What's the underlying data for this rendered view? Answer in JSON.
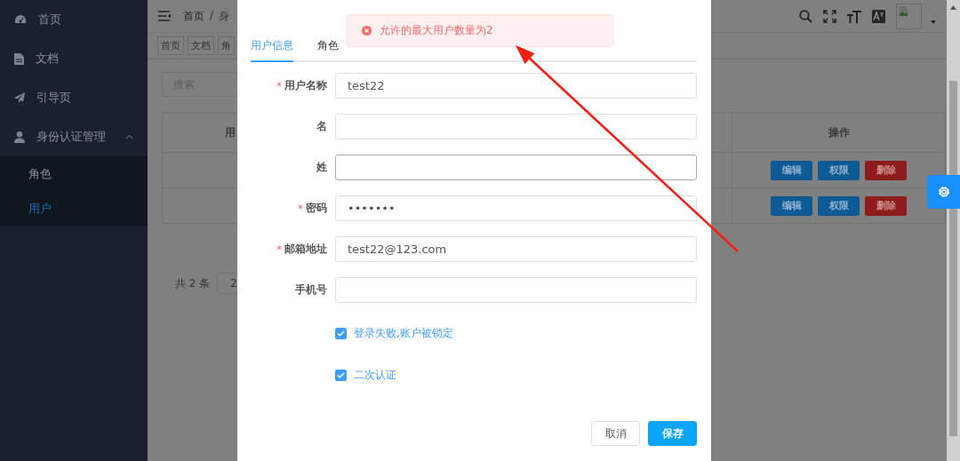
{
  "sidebar": {
    "items": [
      {
        "label": "首页",
        "selected": false
      },
      {
        "label": "文档",
        "selected": false
      },
      {
        "label": "引导页",
        "selected": false
      },
      {
        "label": "身份认证管理",
        "selected": false,
        "expanded": true,
        "children": [
          {
            "label": "角色",
            "selected": false
          },
          {
            "label": "用户",
            "selected": true
          }
        ]
      }
    ]
  },
  "header": {
    "breadcrumb": [
      "首页",
      "身"
    ],
    "breadcrumb_separator": "/"
  },
  "tags": [
    "首页",
    "文档",
    "角"
  ],
  "search": {
    "placeholder": "搜索"
  },
  "table": {
    "columns": [
      "用",
      "操作"
    ],
    "rows": [
      {
        "actions": [
          {
            "label": "编辑",
            "kind": "primary"
          },
          {
            "label": "权限",
            "kind": "primary"
          },
          {
            "label": "删除",
            "kind": "danger"
          }
        ]
      },
      {
        "actions": [
          {
            "label": "编辑",
            "kind": "primary"
          },
          {
            "label": "权限",
            "kind": "primary"
          },
          {
            "label": "删除",
            "kind": "danger"
          }
        ]
      }
    ]
  },
  "pagination": {
    "total": "共 2 条",
    "page_size": "2"
  },
  "modal": {
    "tabs": [
      {
        "label": "用户信息",
        "selected": true
      },
      {
        "label": "角色",
        "selected": false
      }
    ],
    "fields": [
      {
        "label": "用户名称",
        "required_mark": "*",
        "value": "test22",
        "focused": false
      },
      {
        "label": "名",
        "focused": false
      },
      {
        "label": "姓",
        "focused": true
      },
      {
        "label": "密码",
        "required_mark": "*",
        "value": "•••••••",
        "focused": false
      },
      {
        "label": "邮箱地址",
        "required_mark": "*",
        "value": "test22@123.com",
        "focused": false
      },
      {
        "label": "手机号",
        "focused": false
      }
    ],
    "checkboxes": [
      {
        "label": "登录失败,账户被锁定",
        "checked": true
      },
      {
        "label": "二次认证",
        "checked": true
      }
    ],
    "buttons": [
      {
        "label": "取消",
        "kind": "default"
      },
      {
        "label": "保存",
        "kind": "primary"
      }
    ]
  },
  "toast": {
    "kind": "error",
    "message": "允许的最大用户数量为2"
  }
}
